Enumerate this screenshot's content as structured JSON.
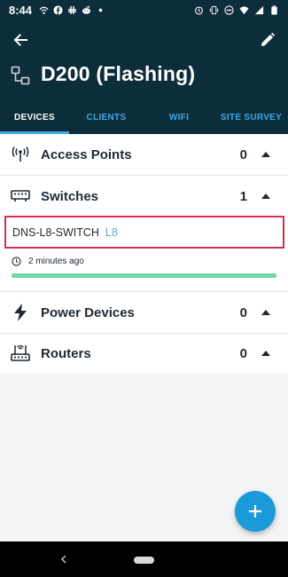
{
  "status_bar": {
    "time": "8:44",
    "left_icons": [
      "wifi-calling-icon",
      "facebook-icon",
      "slack-icon",
      "reddit-icon",
      "dot-icon"
    ],
    "right_icons": [
      "alarm-icon",
      "vibrate-icon",
      "dnd-icon",
      "wifi-icon",
      "signal-icon",
      "battery-icon"
    ]
  },
  "appbar": {
    "back_icon": "arrow-left-icon",
    "edit_icon": "pencil-icon"
  },
  "header": {
    "site_icon": "network-icon",
    "title": "D200 (Flashing)"
  },
  "tabs": [
    {
      "label": "DEVICES",
      "active": true
    },
    {
      "label": "CLIENTS",
      "active": false
    },
    {
      "label": "WIFI",
      "active": false
    },
    {
      "label": "SITE SURVEY",
      "active": false
    }
  ],
  "sections": [
    {
      "label": "Access Points",
      "count": "0",
      "icon": "antenna-icon",
      "expanded": true
    },
    {
      "label": "Switches",
      "count": "1",
      "icon": "switch-icon",
      "expanded": true
    },
    {
      "label": "Power Devices",
      "count": "0",
      "icon": "lightning-icon",
      "expanded": true
    },
    {
      "label": "Routers",
      "count": "0",
      "icon": "router-icon",
      "expanded": true
    }
  ],
  "switch_device": {
    "name": "DNS-L8-SWITCH",
    "model": "L8",
    "last_seen": "2 minutes ago",
    "progress": 1.0
  },
  "fab": {
    "icon": "plus-icon"
  },
  "colors": {
    "header_bg": "#0c2d3a",
    "tab_accent": "#3fa9e6",
    "selection_border": "#d0304b",
    "progress": "#6fd6a0",
    "fab": "#1a9ad8"
  }
}
